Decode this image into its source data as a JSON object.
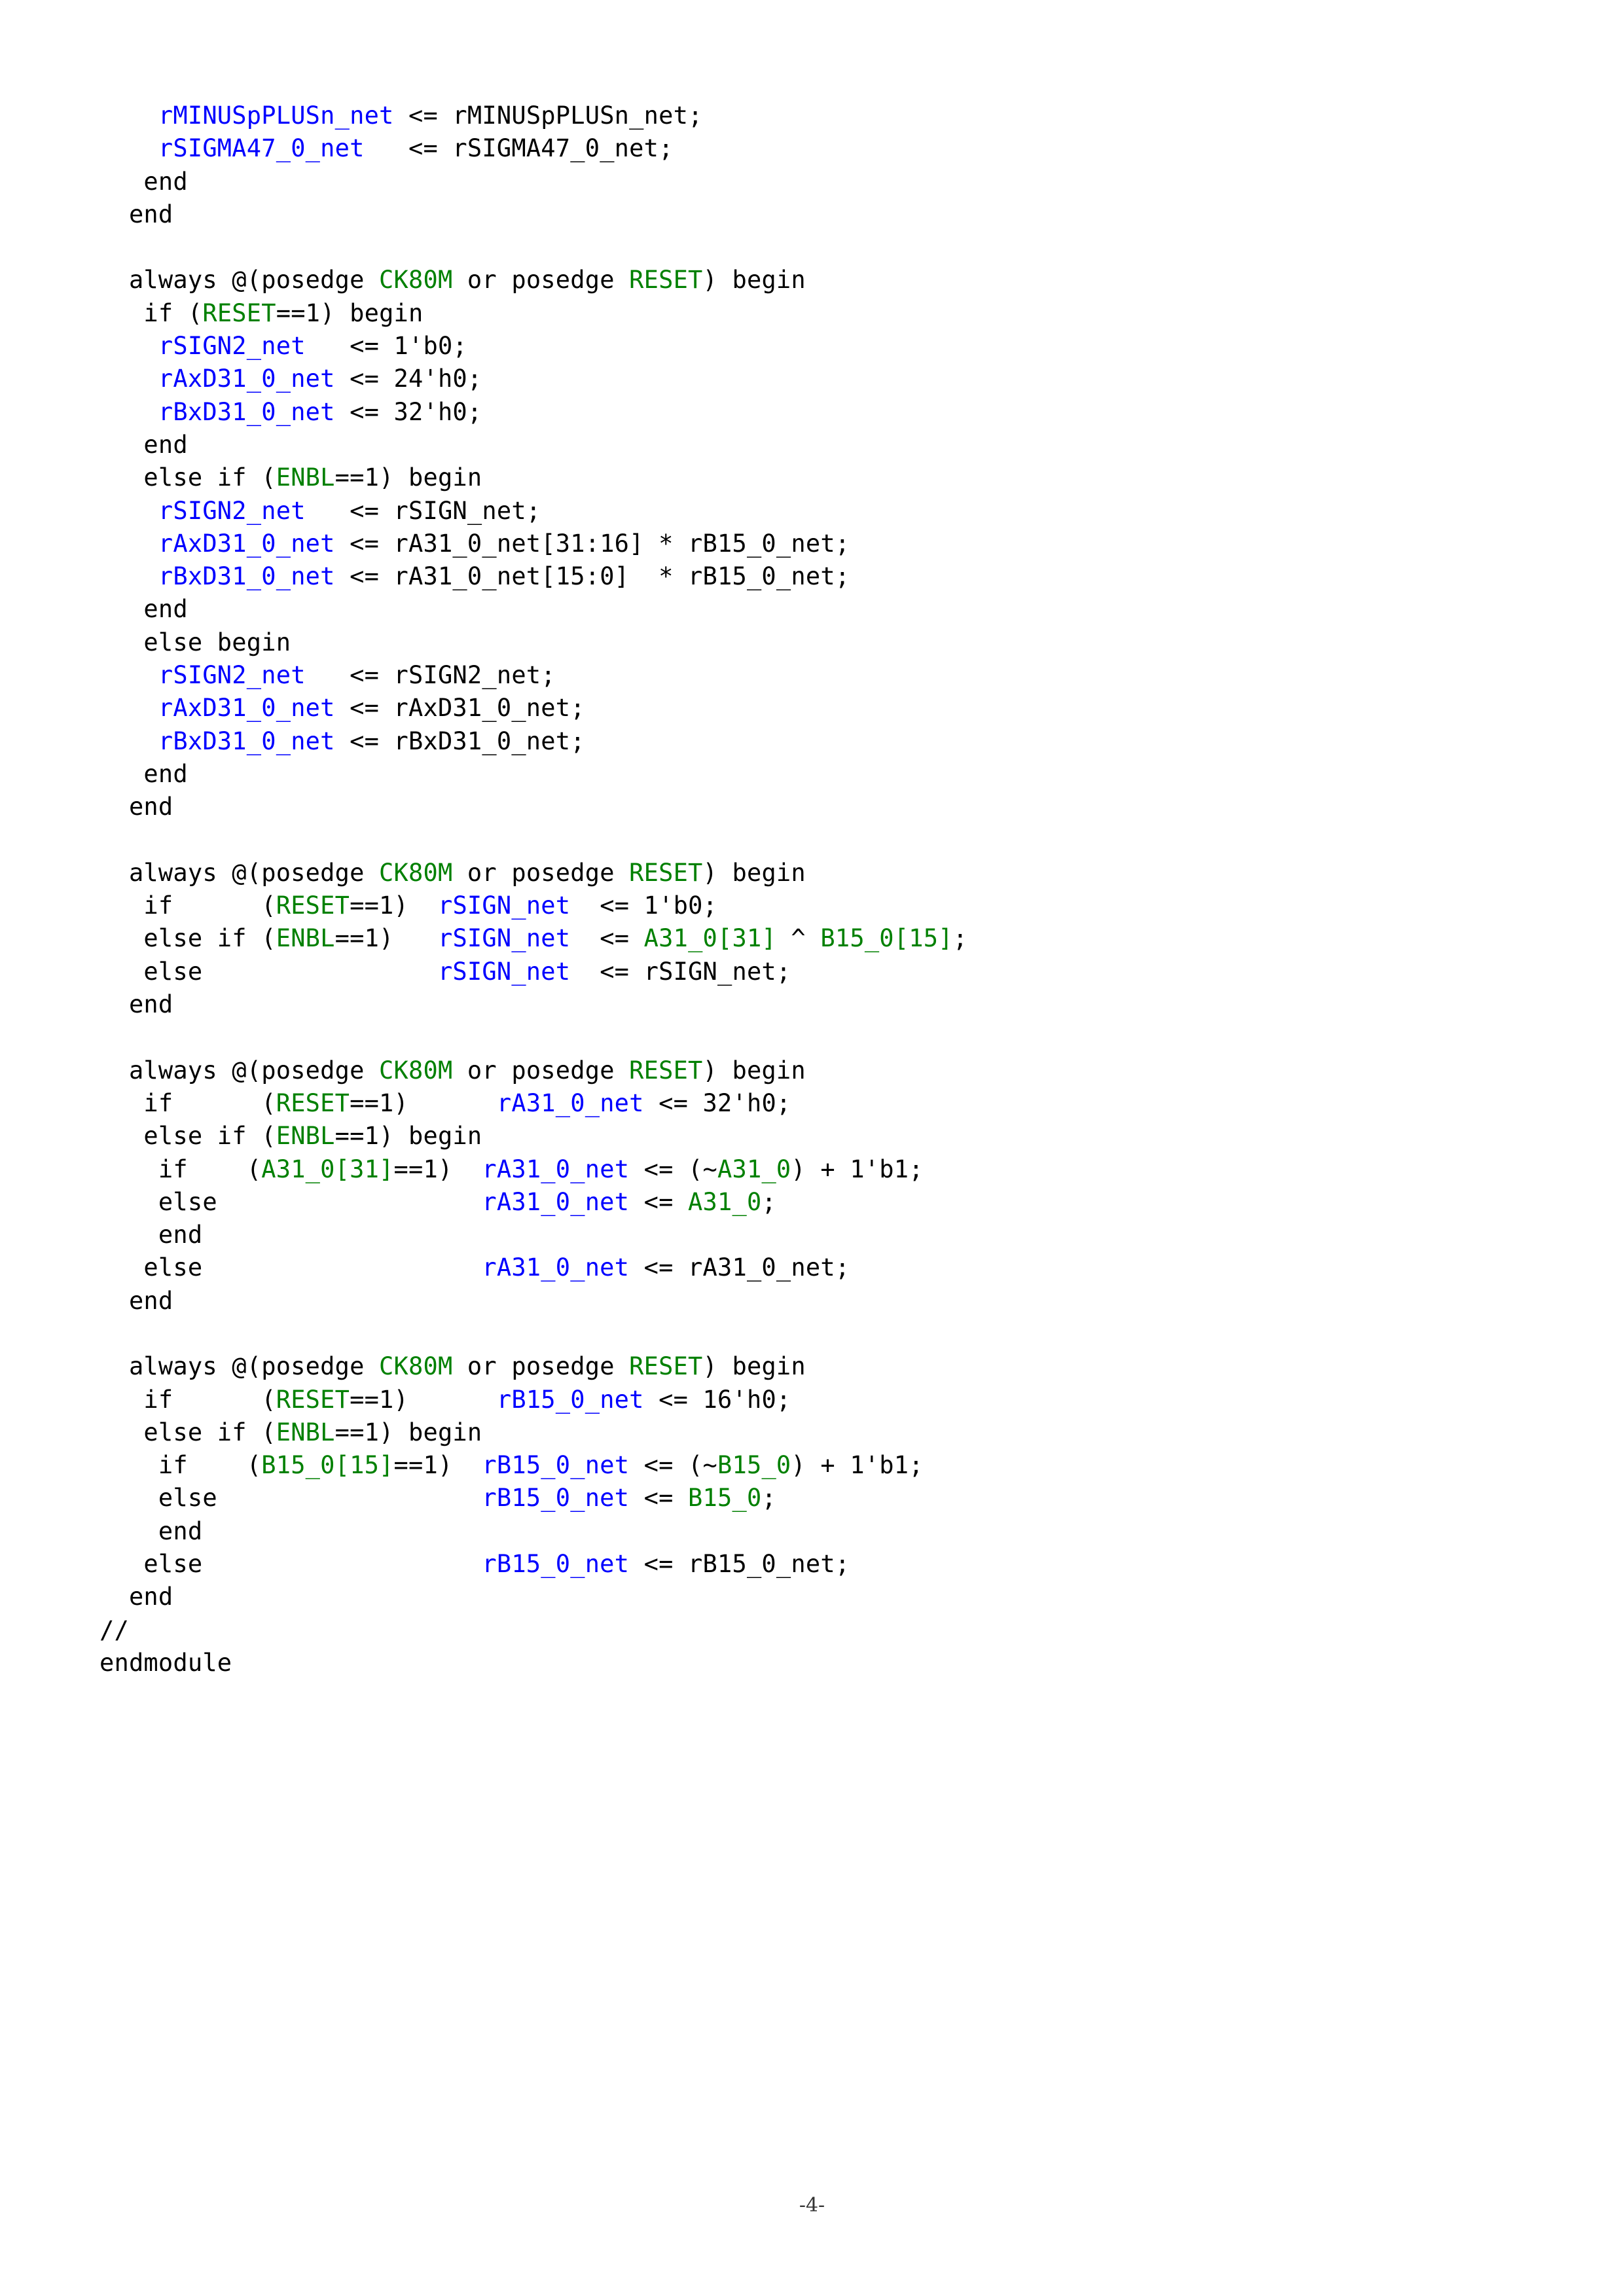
{
  "colors": {
    "default": "#000000",
    "reg": "#0000ff",
    "sig": "#008000"
  },
  "code_lines": [
    [
      {
        "t": "    ",
        "c": "default"
      },
      {
        "t": "rMINUSpPLUSn_net",
        "c": "reg"
      },
      {
        "t": " <= rMINUSpPLUSn_net;",
        "c": "default"
      }
    ],
    [
      {
        "t": "    ",
        "c": "default"
      },
      {
        "t": "rSIGMA47_0_net",
        "c": "reg"
      },
      {
        "t": "   <= rSIGMA47_0_net;",
        "c": "default"
      }
    ],
    [
      {
        "t": "   end",
        "c": "default"
      }
    ],
    [
      {
        "t": "  end",
        "c": "default"
      }
    ],
    [
      {
        "t": "",
        "c": "default"
      }
    ],
    [
      {
        "t": "  always @(posedge ",
        "c": "default"
      },
      {
        "t": "CK80M",
        "c": "sig"
      },
      {
        "t": " or posedge ",
        "c": "default"
      },
      {
        "t": "RESET",
        "c": "sig"
      },
      {
        "t": ") begin",
        "c": "default"
      }
    ],
    [
      {
        "t": "   if (",
        "c": "default"
      },
      {
        "t": "RESET",
        "c": "sig"
      },
      {
        "t": "==1) begin",
        "c": "default"
      }
    ],
    [
      {
        "t": "    ",
        "c": "default"
      },
      {
        "t": "rSIGN2_net",
        "c": "reg"
      },
      {
        "t": "   <= 1'b0;",
        "c": "default"
      }
    ],
    [
      {
        "t": "    ",
        "c": "default"
      },
      {
        "t": "rAxD31_0_net",
        "c": "reg"
      },
      {
        "t": " <= 24'h0;",
        "c": "default"
      }
    ],
    [
      {
        "t": "    ",
        "c": "default"
      },
      {
        "t": "rBxD31_0_net",
        "c": "reg"
      },
      {
        "t": " <= 32'h0;",
        "c": "default"
      }
    ],
    [
      {
        "t": "   end",
        "c": "default"
      }
    ],
    [
      {
        "t": "   else if (",
        "c": "default"
      },
      {
        "t": "ENBL",
        "c": "sig"
      },
      {
        "t": "==1) begin",
        "c": "default"
      }
    ],
    [
      {
        "t": "    ",
        "c": "default"
      },
      {
        "t": "rSIGN2_net",
        "c": "reg"
      },
      {
        "t": "   <= rSIGN_net;",
        "c": "default"
      }
    ],
    [
      {
        "t": "    ",
        "c": "default"
      },
      {
        "t": "rAxD31_0_net",
        "c": "reg"
      },
      {
        "t": " <= rA31_0_net[31:16] * rB15_0_net;",
        "c": "default"
      }
    ],
    [
      {
        "t": "    ",
        "c": "default"
      },
      {
        "t": "rBxD31_0_net",
        "c": "reg"
      },
      {
        "t": " <= rA31_0_net[15:0]  * rB15_0_net;",
        "c": "default"
      }
    ],
    [
      {
        "t": "   end",
        "c": "default"
      }
    ],
    [
      {
        "t": "   else begin",
        "c": "default"
      }
    ],
    [
      {
        "t": "    ",
        "c": "default"
      },
      {
        "t": "rSIGN2_net",
        "c": "reg"
      },
      {
        "t": "   <= rSIGN2_net;",
        "c": "default"
      }
    ],
    [
      {
        "t": "    ",
        "c": "default"
      },
      {
        "t": "rAxD31_0_net",
        "c": "reg"
      },
      {
        "t": " <= rAxD31_0_net;",
        "c": "default"
      }
    ],
    [
      {
        "t": "    ",
        "c": "default"
      },
      {
        "t": "rBxD31_0_net",
        "c": "reg"
      },
      {
        "t": " <= rBxD31_0_net;",
        "c": "default"
      }
    ],
    [
      {
        "t": "   end",
        "c": "default"
      }
    ],
    [
      {
        "t": "  end",
        "c": "default"
      }
    ],
    [
      {
        "t": "",
        "c": "default"
      }
    ],
    [
      {
        "t": "  always @(posedge ",
        "c": "default"
      },
      {
        "t": "CK80M",
        "c": "sig"
      },
      {
        "t": " or posedge ",
        "c": "default"
      },
      {
        "t": "RESET",
        "c": "sig"
      },
      {
        "t": ") begin",
        "c": "default"
      }
    ],
    [
      {
        "t": "   if      (",
        "c": "default"
      },
      {
        "t": "RESET",
        "c": "sig"
      },
      {
        "t": "==1)  ",
        "c": "default"
      },
      {
        "t": "rSIGN_net",
        "c": "reg"
      },
      {
        "t": "  <= 1'b0;",
        "c": "default"
      }
    ],
    [
      {
        "t": "   else if (",
        "c": "default"
      },
      {
        "t": "ENBL",
        "c": "sig"
      },
      {
        "t": "==1)   ",
        "c": "default"
      },
      {
        "t": "rSIGN_net",
        "c": "reg"
      },
      {
        "t": "  <= ",
        "c": "default"
      },
      {
        "t": "A31_0[31]",
        "c": "sig"
      },
      {
        "t": " ^ ",
        "c": "default"
      },
      {
        "t": "B15_0[15]",
        "c": "sig"
      },
      {
        "t": ";",
        "c": "default"
      }
    ],
    [
      {
        "t": "   else                ",
        "c": "default"
      },
      {
        "t": "rSIGN_net",
        "c": "reg"
      },
      {
        "t": "  <= rSIGN_net;",
        "c": "default"
      }
    ],
    [
      {
        "t": "  end",
        "c": "default"
      }
    ],
    [
      {
        "t": "",
        "c": "default"
      }
    ],
    [
      {
        "t": "  always @(posedge ",
        "c": "default"
      },
      {
        "t": "CK80M",
        "c": "sig"
      },
      {
        "t": " or posedge ",
        "c": "default"
      },
      {
        "t": "RESET",
        "c": "sig"
      },
      {
        "t": ") begin",
        "c": "default"
      }
    ],
    [
      {
        "t": "   if      (",
        "c": "default"
      },
      {
        "t": "RESET",
        "c": "sig"
      },
      {
        "t": "==1)      ",
        "c": "default"
      },
      {
        "t": "rA31_0_net",
        "c": "reg"
      },
      {
        "t": " <= 32'h0;",
        "c": "default"
      }
    ],
    [
      {
        "t": "   else if (",
        "c": "default"
      },
      {
        "t": "ENBL",
        "c": "sig"
      },
      {
        "t": "==1) begin",
        "c": "default"
      }
    ],
    [
      {
        "t": "    if    (",
        "c": "default"
      },
      {
        "t": "A31_0[31]",
        "c": "sig"
      },
      {
        "t": "==1)  ",
        "c": "default"
      },
      {
        "t": "rA31_0_net",
        "c": "reg"
      },
      {
        "t": " <= (~",
        "c": "default"
      },
      {
        "t": "A31_0",
        "c": "sig"
      },
      {
        "t": ") + 1'b1;",
        "c": "default"
      }
    ],
    [
      {
        "t": "    else                  ",
        "c": "default"
      },
      {
        "t": "rA31_0_net",
        "c": "reg"
      },
      {
        "t": " <= ",
        "c": "default"
      },
      {
        "t": "A31_0",
        "c": "sig"
      },
      {
        "t": ";",
        "c": "default"
      }
    ],
    [
      {
        "t": "    end",
        "c": "default"
      }
    ],
    [
      {
        "t": "   else                   ",
        "c": "default"
      },
      {
        "t": "rA31_0_net",
        "c": "reg"
      },
      {
        "t": " <= rA31_0_net;",
        "c": "default"
      }
    ],
    [
      {
        "t": "  end",
        "c": "default"
      }
    ],
    [
      {
        "t": "",
        "c": "default"
      }
    ],
    [
      {
        "t": "  always @(posedge ",
        "c": "default"
      },
      {
        "t": "CK80M",
        "c": "sig"
      },
      {
        "t": " or posedge ",
        "c": "default"
      },
      {
        "t": "RESET",
        "c": "sig"
      },
      {
        "t": ") begin",
        "c": "default"
      }
    ],
    [
      {
        "t": "   if      (",
        "c": "default"
      },
      {
        "t": "RESET",
        "c": "sig"
      },
      {
        "t": "==1)      ",
        "c": "default"
      },
      {
        "t": "rB15_0_net",
        "c": "reg"
      },
      {
        "t": " <= 16'h0;",
        "c": "default"
      }
    ],
    [
      {
        "t": "   else if (",
        "c": "default"
      },
      {
        "t": "ENBL",
        "c": "sig"
      },
      {
        "t": "==1) begin",
        "c": "default"
      }
    ],
    [
      {
        "t": "    if    (",
        "c": "default"
      },
      {
        "t": "B15_0[15]",
        "c": "sig"
      },
      {
        "t": "==1)  ",
        "c": "default"
      },
      {
        "t": "rB15_0_net",
        "c": "reg"
      },
      {
        "t": " <= (~",
        "c": "default"
      },
      {
        "t": "B15_0",
        "c": "sig"
      },
      {
        "t": ") + 1'b1;",
        "c": "default"
      }
    ],
    [
      {
        "t": "    else                  ",
        "c": "default"
      },
      {
        "t": "rB15_0_net",
        "c": "reg"
      },
      {
        "t": " <= ",
        "c": "default"
      },
      {
        "t": "B15_0",
        "c": "sig"
      },
      {
        "t": ";",
        "c": "default"
      }
    ],
    [
      {
        "t": "    end",
        "c": "default"
      }
    ],
    [
      {
        "t": "   else                   ",
        "c": "default"
      },
      {
        "t": "rB15_0_net",
        "c": "reg"
      },
      {
        "t": " <= rB15_0_net;",
        "c": "default"
      }
    ],
    [
      {
        "t": "  end",
        "c": "default"
      }
    ],
    [
      {
        "t": "//",
        "c": "default"
      }
    ],
    [
      {
        "t": "endmodule",
        "c": "default"
      }
    ]
  ],
  "page_number": "-4-"
}
